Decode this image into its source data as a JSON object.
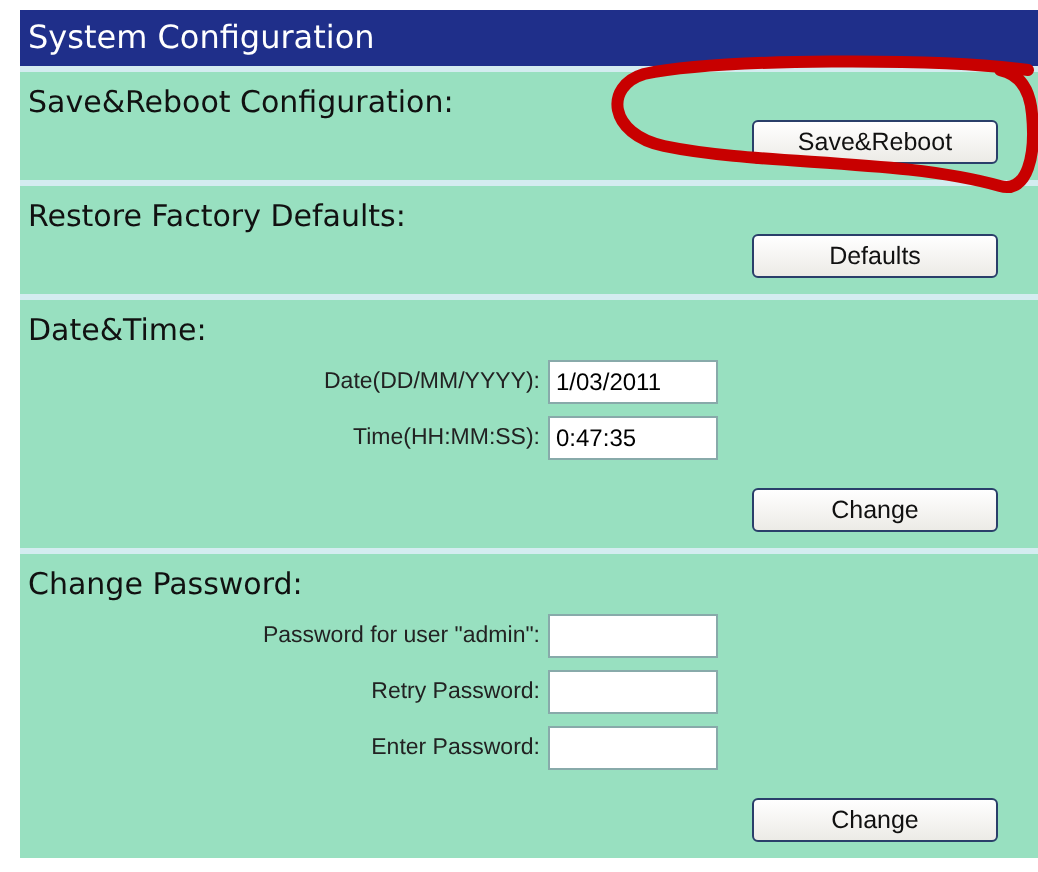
{
  "title": "System Configuration",
  "annotation_circle": true,
  "sections": [
    {
      "heading": "Save&Reboot Configuration:",
      "button": "Save&Reboot"
    },
    {
      "heading": "Restore Factory Defaults:",
      "button": "Defaults"
    },
    {
      "heading": "Date&Time:",
      "fields": [
        {
          "label": "Date(DD/MM/YYYY):",
          "value": "1/03/2011"
        },
        {
          "label": "Time(HH:MM:SS):",
          "value": "0:47:35"
        }
      ],
      "button": "Change"
    },
    {
      "heading": "Change Password:",
      "fields": [
        {
          "label": "Password for user \"admin\":"
        },
        {
          "label": "Retry Password:"
        },
        {
          "label": "Enter Password:"
        }
      ],
      "button": "Change"
    }
  ]
}
